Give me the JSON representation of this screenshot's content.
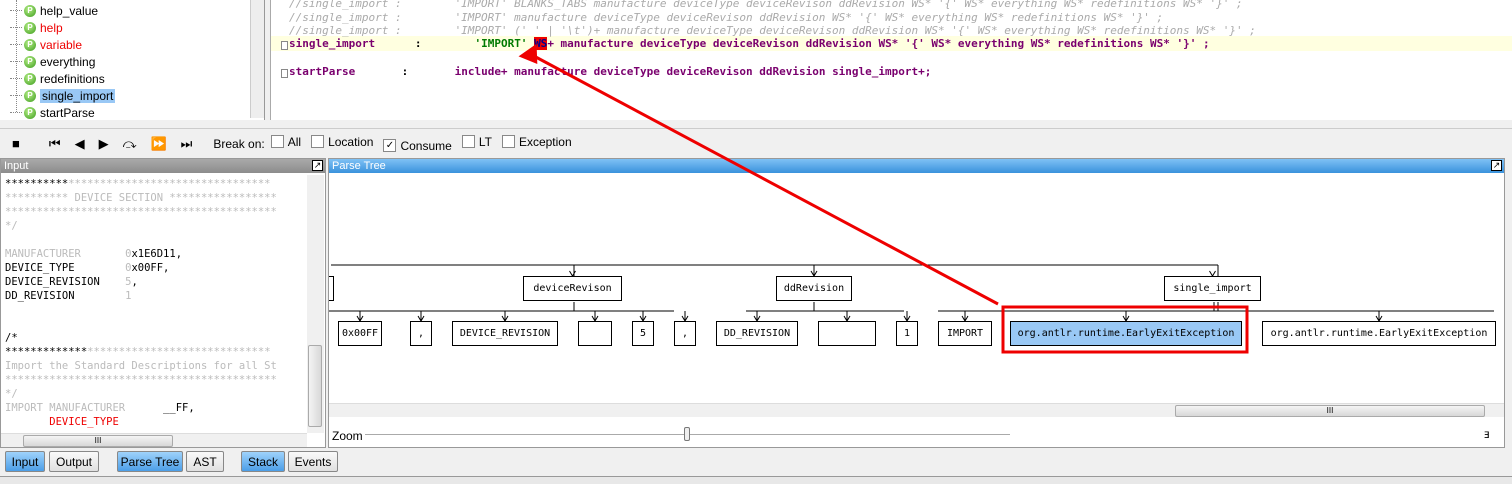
{
  "rules": [
    {
      "label": "help_value",
      "state": "normal"
    },
    {
      "label": "help",
      "state": "error"
    },
    {
      "label": "variable",
      "state": "error"
    },
    {
      "label": "everything",
      "state": "normal"
    },
    {
      "label": "redefinitions",
      "state": "normal"
    },
    {
      "label": "single_import",
      "state": "selected"
    },
    {
      "label": "startParse",
      "state": "normal"
    }
  ],
  "rule_icon": "P",
  "editor": {
    "comment_lines": [
      "//single_import :        'IMPORT' BLANKS_TABS manufacture deviceType deviceRevison ddRevision WS* '{' WS* everything WS* redefinitions WS* '}' ;",
      "//single_import :        'IMPORT' manufacture deviceType deviceRevison ddRevision WS* '{' WS* everything WS* redefinitions WS* '}' ;",
      "//single_import :        'IMPORT' (' ' | '\\t')+ manufacture deviceType deviceRevison ddRevision WS* '{' WS* everything WS* redefinitions WS* '}' ;"
    ],
    "current": {
      "name": "single_import",
      "colon": ":",
      "literal": "'IMPORT'",
      "ws": "WS",
      "rest": "+ manufacture deviceType deviceRevison ddRevision WS* '{' WS* everything WS* redefinitions WS* '}' ;"
    },
    "startparse": {
      "name": "startParse",
      "colon": ":",
      "body": "include+ manufacture deviceType deviceRevison ddRevision single_import+;"
    }
  },
  "toolbar": {
    "break_on": "Break on:",
    "checks": [
      {
        "label": "All",
        "checked": false
      },
      {
        "label": "Location",
        "checked": false
      },
      {
        "label": "Consume",
        "checked": true
      },
      {
        "label": "LT",
        "checked": false
      },
      {
        "label": "Exception",
        "checked": false
      }
    ]
  },
  "input_panel": {
    "title": "Input",
    "lines": [
      {
        "b": "**********",
        "g": "********************************"
      },
      {
        "b": "",
        "g": "********** DEVICE SECTION *****************"
      },
      {
        "b": "",
        "g": "*******************************************"
      },
      {
        "b": "",
        "g": "*/"
      },
      {
        "b": "",
        "g": ""
      },
      {
        "b": "",
        "g": "MANUFACTURER       0",
        "t": "x1E6D11,"
      },
      {
        "b": "DEVICE_TYPE        ",
        "g": "0",
        "t": "x00FF,"
      },
      {
        "b": "DEVICE_REVISION    ",
        "g": "5",
        "t": ","
      },
      {
        "b": "DD_REVISION        ",
        "g": "1"
      },
      {
        "b": "",
        "g": ""
      },
      {
        "b": "",
        "g": ""
      },
      {
        "b": "/*",
        "g": ""
      },
      {
        "b": "*************",
        "g": "*****************************"
      },
      {
        "b": "",
        "g": "Import the Standard Descriptions for all St"
      },
      {
        "b": "",
        "g": "*******************************************"
      },
      {
        "b": "",
        "g": "*/"
      },
      {
        "b": "",
        "g": "IMPORT MANUFACTURER      ",
        "t": "__FF,"
      },
      {
        "b": "",
        "g": "       ",
        "r": "DEVICE_TYPE"
      }
    ]
  },
  "parse_tree": {
    "title": "Parse Tree",
    "level1": [
      "deviceRevison",
      "ddRevision",
      "single_import"
    ],
    "leaves": [
      "0x00FF",
      ",",
      "DEVICE_REVISION",
      "",
      "5",
      ",",
      "DD_REVISION",
      "",
      "1",
      "IMPORT",
      "org.antlr.runtime.EarlyExitException",
      "org.antlr.runtime.EarlyExitException"
    ],
    "zoom_label": "Zoom",
    "zoom_value": 0.5
  },
  "tabs": [
    "Input",
    "Output",
    "Parse Tree",
    "AST",
    "Stack",
    "Events"
  ]
}
